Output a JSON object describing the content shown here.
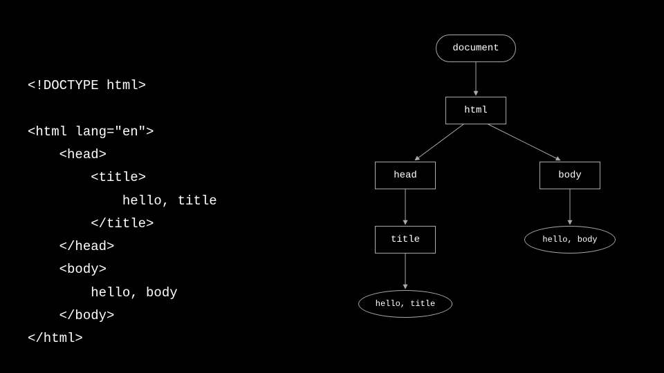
{
  "code": {
    "l1": "<!DOCTYPE html>",
    "l2": "",
    "l3": "<html lang=\"en\">",
    "l4": "    <head>",
    "l5": "        <title>",
    "l6": "            hello, title",
    "l7": "        </title>",
    "l8": "    </head>",
    "l9": "    <body>",
    "l10": "        hello, body",
    "l11": "    </body>",
    "l12": "</html>"
  },
  "tree": {
    "document": "document",
    "html": "html",
    "head": "head",
    "body": "body",
    "title": "title",
    "text_title": "hello, title",
    "text_body": "hello, body"
  }
}
